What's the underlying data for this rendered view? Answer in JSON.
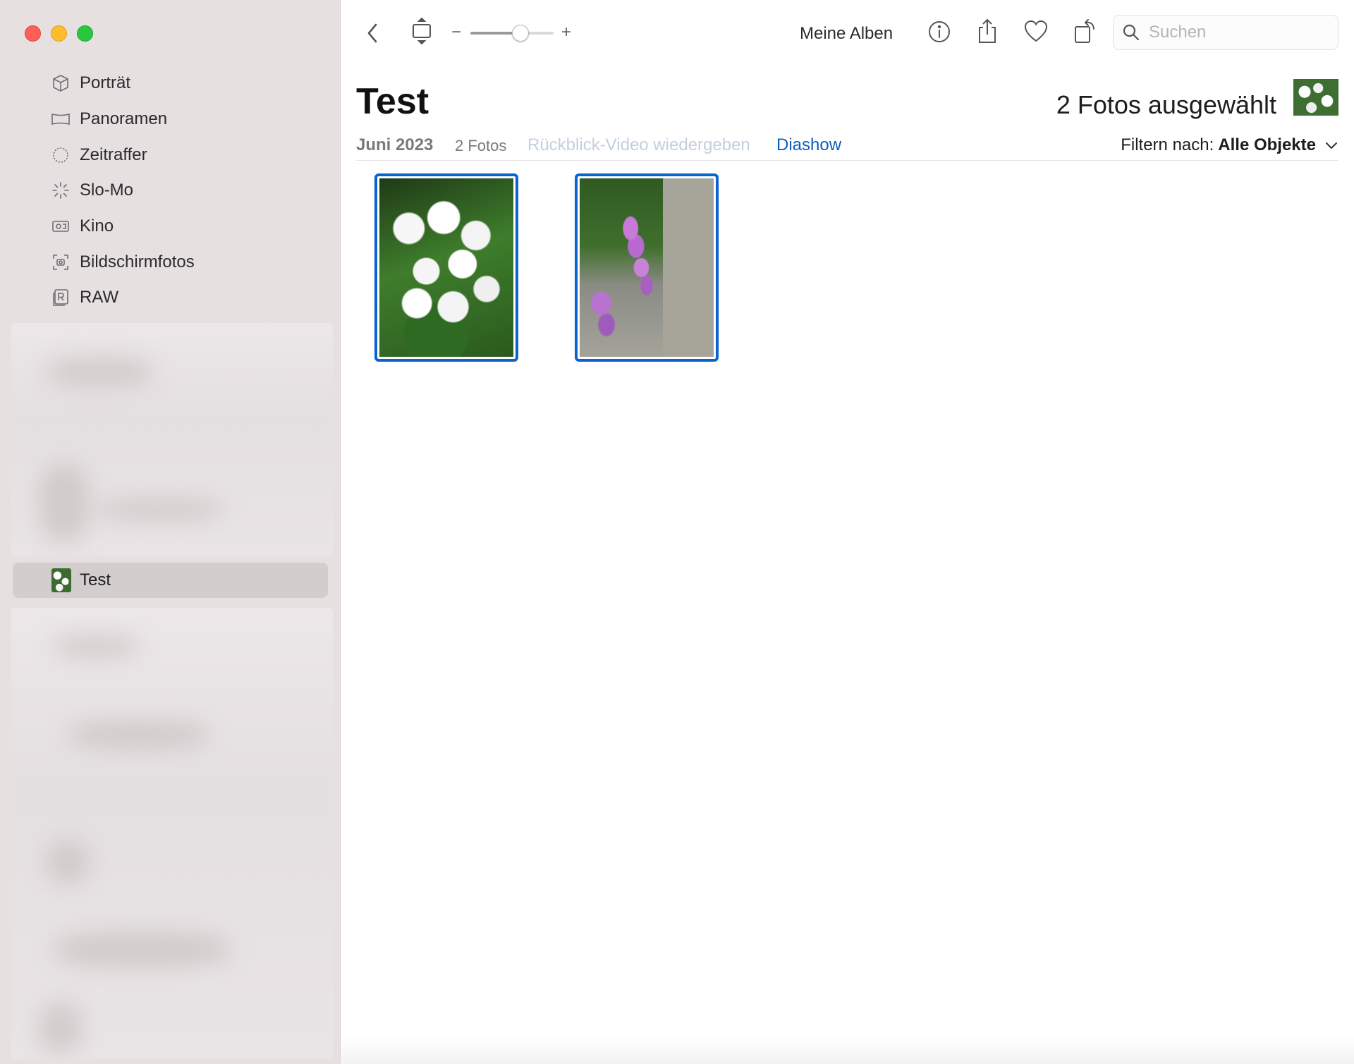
{
  "sidebar": {
    "items": [
      {
        "label": "Porträt",
        "icon": "cube-icon"
      },
      {
        "label": "Panoramen",
        "icon": "panorama-icon"
      },
      {
        "label": "Zeitraffer",
        "icon": "timelapse-icon"
      },
      {
        "label": "Slo-Mo",
        "icon": "slomo-icon"
      },
      {
        "label": "Kino",
        "icon": "cinematic-icon"
      },
      {
        "label": "Bildschirmfotos",
        "icon": "screenshot-icon"
      },
      {
        "label": "RAW",
        "icon": "raw-icon"
      }
    ],
    "selected_album": {
      "label": "Test",
      "icon": "album-thumbnail"
    }
  },
  "toolbar": {
    "zoom_minus": "−",
    "zoom_plus": "+",
    "zoom_level": 0.6,
    "label": "Meine Alben",
    "search_placeholder": "Suchen"
  },
  "content": {
    "title": "Test",
    "selected_count": "2 Fotos ausgewählt",
    "date": "Juni 2023",
    "photo_count": "2 Fotos",
    "memory_link": "Rückblick-Video wiedergeben",
    "slideshow_link": "Diashow",
    "filter_label": "Filtern nach:",
    "filter_value": "Alle Objekte"
  },
  "photos": [
    {
      "subject": "white-dogwood-flowers",
      "selected": true
    },
    {
      "subject": "purple-foxglove",
      "selected": true
    }
  ],
  "colors": {
    "sidebar_bg": "#e6e0e1",
    "selection_blue": "#0b63d1",
    "link_blue": "#0a5dc2",
    "disabled_link": "#c3cfdf"
  }
}
